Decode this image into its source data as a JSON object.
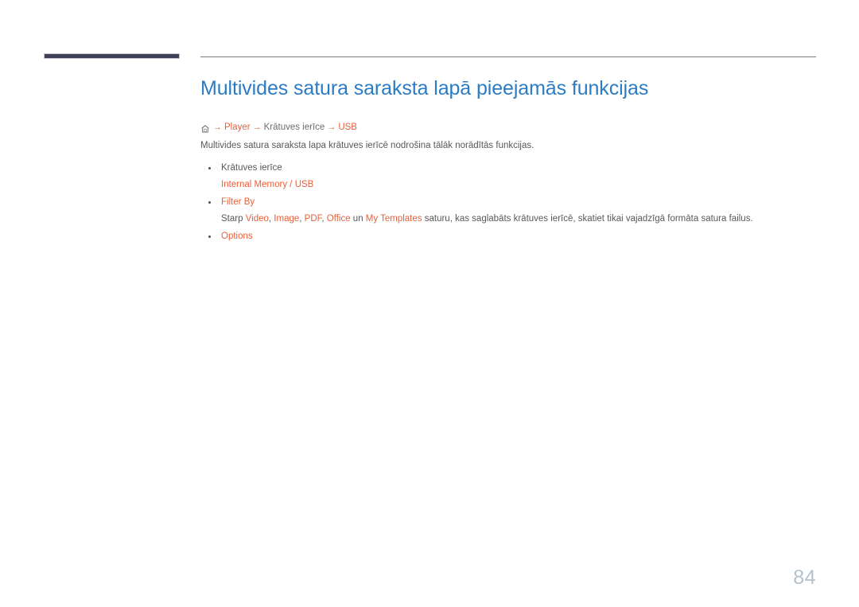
{
  "document": {
    "page_number": "84",
    "title": "Multivides satura saraksta lapā pieejamās funkcijas"
  },
  "colors": {
    "title_blue": "#2b7cc4",
    "accent_orange": "#e8603c",
    "body_gray": "#58585b",
    "crumb_gray": "#6e6e72",
    "corner_bar_navy": "#3f3f56",
    "rule_gray": "#7b7b80",
    "page_number_gray": "#b4c2cc"
  },
  "breadcrumb": {
    "home_icon": "home-icon",
    "arrow": "→",
    "items": [
      {
        "label": "Player",
        "accent": true
      },
      {
        "label": "Krātuves ierīce",
        "accent": false
      },
      {
        "label": "USB",
        "accent": true
      }
    ]
  },
  "intro": "Multivides satura saraksta lapa krātuves ierīcē nodrošina tālāk norādītās funkcijas.",
  "bullets": [
    {
      "head": "Krātuves ierīce",
      "head_accent": false,
      "sub_parts": [
        {
          "text": "Internal Memory",
          "accent": true
        },
        {
          "text": " / ",
          "accent": true
        },
        {
          "text": "USB",
          "accent": true
        }
      ]
    },
    {
      "head": "Filter By",
      "head_accent": true,
      "sub_parts": [
        {
          "text": "Starp ",
          "accent": false
        },
        {
          "text": "Video",
          "accent": true
        },
        {
          "text": ", ",
          "accent": false
        },
        {
          "text": "Image",
          "accent": true
        },
        {
          "text": ", ",
          "accent": false
        },
        {
          "text": "PDF",
          "accent": true
        },
        {
          "text": ", ",
          "accent": false
        },
        {
          "text": "Office",
          "accent": true
        },
        {
          "text": " un ",
          "accent": false
        },
        {
          "text": "My Templates",
          "accent": true
        },
        {
          "text": " saturu, kas saglabāts krātuves ierīcē, skatiet tikai vajadzīgā formāta satura failus.",
          "accent": false
        }
      ]
    },
    {
      "head": "Options",
      "head_accent": true,
      "sub_parts": []
    }
  ]
}
